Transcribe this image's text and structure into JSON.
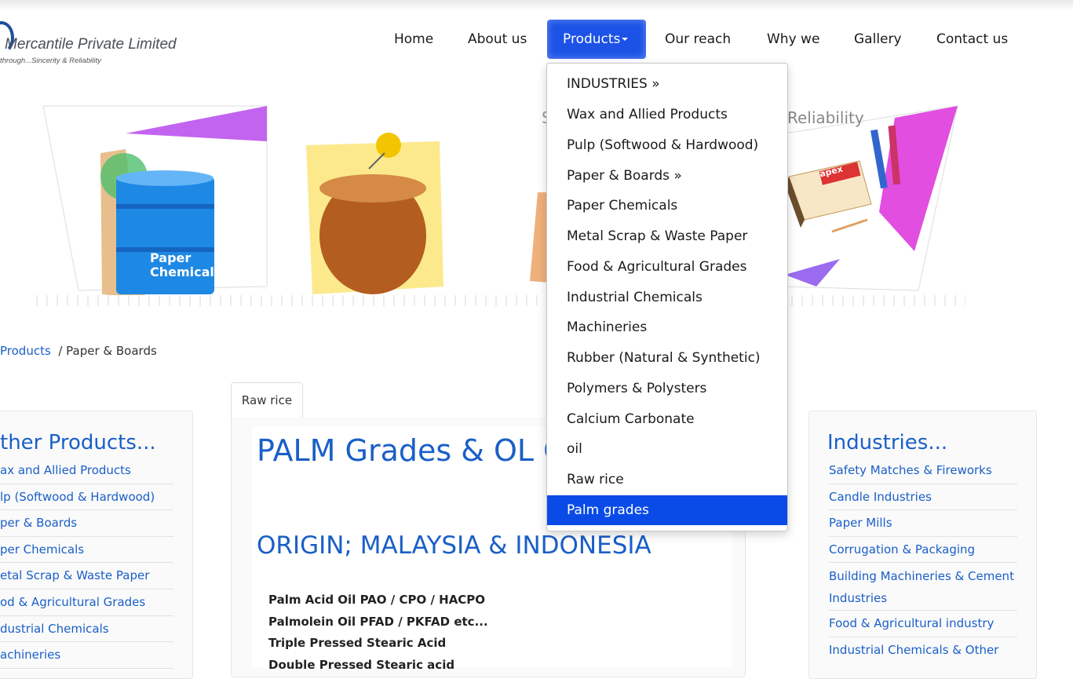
{
  "logo": {
    "name": "Mercantile Private Limited",
    "tagline": "through...Sincerity & Reliability"
  },
  "nav": {
    "items": [
      {
        "label": "Home"
      },
      {
        "label": "About us"
      },
      {
        "label": "Products"
      },
      {
        "label": "Our reach"
      },
      {
        "label": "Why we"
      },
      {
        "label": "Gallery"
      },
      {
        "label": "Contact us"
      }
    ]
  },
  "banner": {
    "paper_drum_label_1": "Paper",
    "paper_drum_label_2": "Chemicals",
    "partial_text_left": "S",
    "partial_text_right": "Reliability",
    "matchbox_brand": "apex"
  },
  "dropdown": {
    "items": [
      {
        "label": "INDUSTRIES  »"
      },
      {
        "label": "Wax and Allied Products"
      },
      {
        "label": "Pulp (Softwood & Hardwood)"
      },
      {
        "label": "Paper & Boards  »"
      },
      {
        "label": "Paper Chemicals"
      },
      {
        "label": "Metal Scrap & Waste Paper"
      },
      {
        "label": "Food & Agricultural Grades"
      },
      {
        "label": "Industrial Chemicals"
      },
      {
        "label": "Machineries"
      },
      {
        "label": "Rubber (Natural & Synthetic)"
      },
      {
        "label": "Polymers & Polysters"
      },
      {
        "label": "Calcium Carbonate"
      },
      {
        "label": "oil"
      },
      {
        "label": "Raw rice"
      },
      {
        "label": "Palm grades"
      }
    ]
  },
  "breadcrumb": {
    "link": "Products",
    "separator": "/",
    "current": "Paper & Boards"
  },
  "tab": {
    "label": "Raw rice"
  },
  "left_panel": {
    "title": "ther Products...",
    "items": [
      {
        "label": "ax and Allied Products"
      },
      {
        "label": "lp (Softwood & Hardwood)"
      },
      {
        "label": "per & Boards"
      },
      {
        "label": "per Chemicals"
      },
      {
        "label": "etal Scrap & Waste Paper"
      },
      {
        "label": "od & Agricultural Grades"
      },
      {
        "label": "dustrial Chemicals"
      },
      {
        "label": "achineries"
      }
    ]
  },
  "main": {
    "title": "PALM Grades & OL CHEMICALS",
    "origin": "ORIGIN; MALAYSIA & INDONESIA",
    "grades": [
      {
        "label": "Palm Acid Oil PAO / CPO / HACPO"
      },
      {
        "label": "Palmolein Oil PFAD / PKFAD etc..."
      },
      {
        "label": "Triple Pressed Stearic Acid"
      },
      {
        "label": "Double Pressed Stearic acid"
      }
    ]
  },
  "right_panel": {
    "title": "Industries...",
    "items": [
      {
        "label": "Safety Matches & Fireworks"
      },
      {
        "label": "Candle Industries"
      },
      {
        "label": "Paper Mills"
      },
      {
        "label": "Corrugation & Packaging"
      },
      {
        "label": "Building Machineries & Cement Industries"
      },
      {
        "label": "Food & Agricultural industry"
      },
      {
        "label": "Industrial Chemicals & Other"
      }
    ]
  },
  "colors": {
    "accent": "#1c52e6",
    "link": "#1a5fc7",
    "dropdown_active": "#0a4be8"
  }
}
